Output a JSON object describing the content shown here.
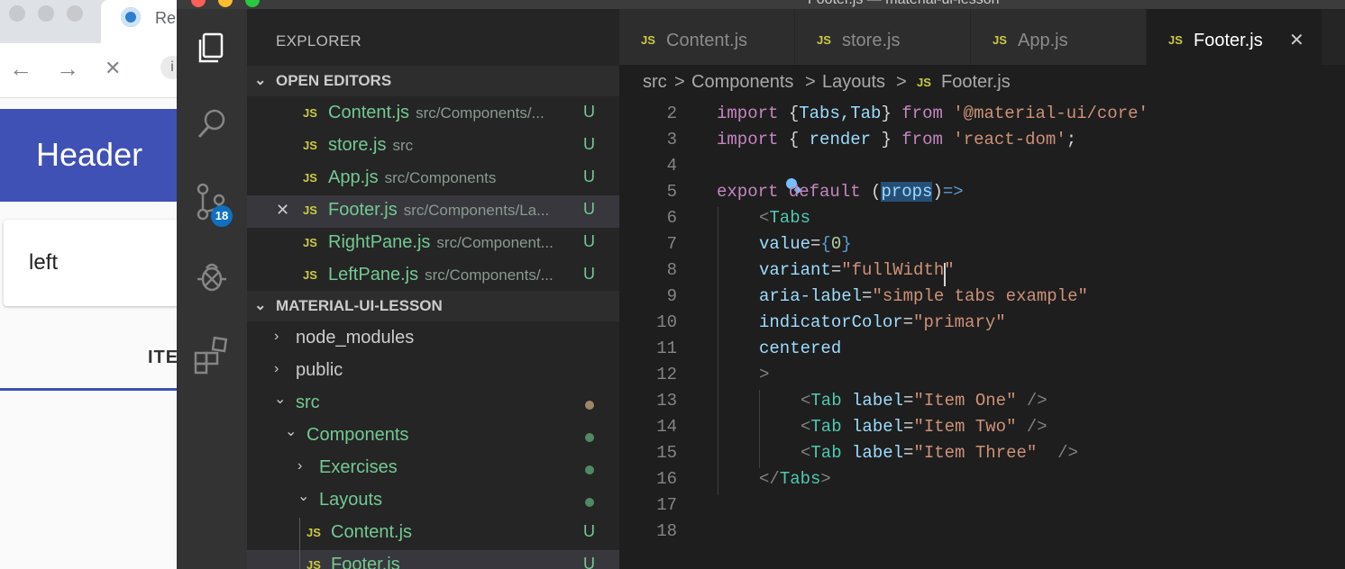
{
  "browser": {
    "tab_title": "Re",
    "nav": {
      "back": "←",
      "forward": "→",
      "stop": "✕",
      "info": "i"
    },
    "app_header": "Header",
    "left_pane": "left",
    "tab_item": "ITE"
  },
  "vscode": {
    "window_title": "Footer.js — material-ui-lesson",
    "activity_badge": "18",
    "explorer": {
      "title": "EXPLORER",
      "open_editors_title": "OPEN EDITORS",
      "open_editors": [
        {
          "name": "Content.js",
          "path": "src/Components/...",
          "status": "U"
        },
        {
          "name": "store.js",
          "path": "src",
          "status": "U"
        },
        {
          "name": "App.js",
          "path": "src/Components",
          "status": "U"
        },
        {
          "name": "Footer.js",
          "path": "src/Components/La...",
          "status": "U",
          "close": "✕"
        },
        {
          "name": "RightPane.js",
          "path": "src/Component...",
          "status": "U"
        },
        {
          "name": "LeftPane.js",
          "path": "src/Components/...",
          "status": "U"
        }
      ],
      "project_title": "MATERIAL-UI-LESSON",
      "tree": [
        {
          "name": "node_modules",
          "chevron": "›"
        },
        {
          "name": "public",
          "chevron": "›"
        },
        {
          "name": "src",
          "chevron": "⌄"
        },
        {
          "name": "Components",
          "chevron": "⌄"
        },
        {
          "name": "Exercises",
          "chevron": "›"
        },
        {
          "name": "Layouts",
          "chevron": "⌄"
        },
        {
          "name": "Content.js",
          "status": "U"
        },
        {
          "name": "Footer.js",
          "status": "U"
        }
      ]
    },
    "tabs": [
      {
        "label": "Content.js"
      },
      {
        "label": "store.js"
      },
      {
        "label": "App.js"
      },
      {
        "label": "Footer.js",
        "close": "✕"
      }
    ],
    "file_badge": "JS",
    "breadcrumb": [
      "src",
      "Components",
      "Layouts",
      "Footer.js"
    ],
    "breadcrumb_sep": ">",
    "line_numbers": [
      "2",
      "3",
      "4",
      "5",
      "6",
      "7",
      "8",
      "9",
      "10",
      "11",
      "12",
      "13",
      "14",
      "15",
      "16",
      "17",
      "18"
    ],
    "code": {
      "l2": {
        "import": "import",
        "open": " {",
        "names": "Tabs,Tab",
        "close": "} ",
        "from": "from",
        "sp": " ",
        "module": "'@material-ui/core'"
      },
      "l3": {
        "import": "import",
        "open": " { ",
        "names": "render",
        "close": " } ",
        "from": "from",
        "sp": " ",
        "module": "'react-dom'",
        "semi": ";"
      },
      "l5": {
        "export": "export",
        "default": " default ",
        "open": "(",
        "param": "props",
        "close": ")",
        "arrow": "=>"
      },
      "l6": {
        "lt": "<",
        "comp": "Tabs"
      },
      "l7": {
        "attr": "value",
        "eq": "=",
        "ob": "{",
        "val": "0",
        "cb": "}"
      },
      "l8": {
        "attr": "variant",
        "eq": "=",
        "val": "\"fullWidth\""
      },
      "l9": {
        "attr": "aria-label",
        "eq": "=",
        "val": "\"simple tabs example\""
      },
      "l10": {
        "attr": "indicatorColor",
        "eq": "=",
        "val": "\"primary\""
      },
      "l11": {
        "attr": "centered"
      },
      "l12": {
        "gt": ">"
      },
      "l13": {
        "lt": "<",
        "comp": "Tab",
        "attr": " label",
        "eq": "=",
        "val": "\"Item One\"",
        "end": " />"
      },
      "l14": {
        "lt": "<",
        "comp": "Tab",
        "attr": " label",
        "eq": "=",
        "val": "\"Item Two\"",
        "end": " />"
      },
      "l15": {
        "lt": "<",
        "comp": "Tab",
        "attr": " label",
        "eq": "=",
        "val": "\"Item Three\"",
        "end": "  />"
      },
      "l16": {
        "lt": "</",
        "comp": "Tabs",
        "gt": ">"
      }
    }
  },
  "colors": {
    "accent": "#0e70c0",
    "untracked": "#73c991",
    "js_icon": "#cbcb41",
    "browser_appbar": "#3f51b5"
  }
}
